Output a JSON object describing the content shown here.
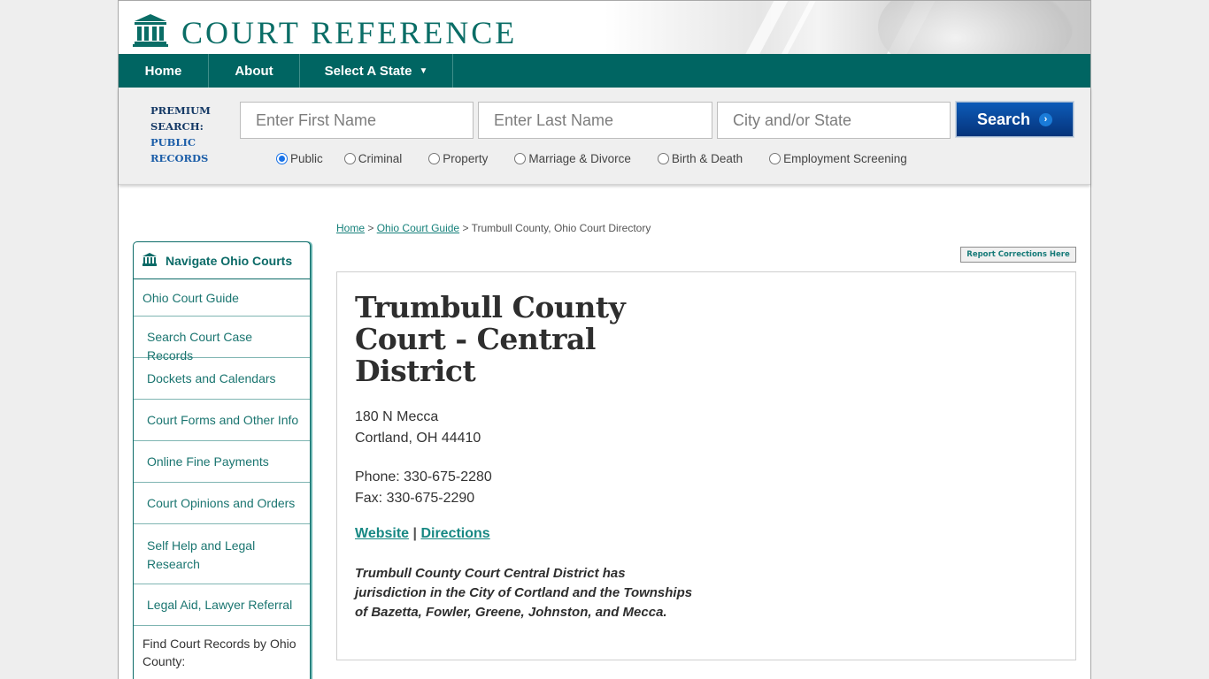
{
  "brand": {
    "name": "COURT REFERENCE",
    "logo_icon": "courthouse-icon",
    "color": "#0a6d66"
  },
  "nav": {
    "items": [
      {
        "label": "Home"
      },
      {
        "label": "About"
      },
      {
        "label": "Select A State",
        "icon": "caret-down-icon"
      }
    ]
  },
  "search": {
    "premium_line1": "PREMIUM",
    "premium_line2": "SEARCH:",
    "premium_line3": "PUBLIC",
    "premium_line4": "RECORDS",
    "first_name_placeholder": "Enter First Name",
    "last_name_placeholder": "Enter Last Name",
    "city_placeholder": "City and/or State",
    "button_label": "Search",
    "button_icon": "chevron-right-icon",
    "button_color": "#0a4fa6",
    "record_types": [
      {
        "label": "Public",
        "selected": true
      },
      {
        "label": "Criminal",
        "selected": false
      },
      {
        "label": "Property",
        "selected": false
      },
      {
        "label": "Marriage & Divorce",
        "selected": false
      },
      {
        "label": "Birth & Death",
        "selected": false
      },
      {
        "label": "Employment Screening",
        "selected": false
      }
    ]
  },
  "breadcrumb": {
    "home": "Home",
    "separator": ">",
    "guide": "Ohio Court Guide",
    "current": "Trumbull County, Ohio Court Directory"
  },
  "report_corrections_label": "Report Corrections Here",
  "sidebar": {
    "title": "Navigate Ohio Courts",
    "title_icon": "courthouse-icon",
    "items": [
      {
        "label": "Ohio Court Guide"
      },
      {
        "label": "Search Court Case Records"
      },
      {
        "label": "Dockets and Calendars"
      },
      {
        "label": "Court Forms and Other Info"
      },
      {
        "label": "Online Fine Payments"
      },
      {
        "label": "Court Opinions and Orders"
      },
      {
        "label": "Self Help and Legal Research"
      },
      {
        "label": "Legal Aid, Lawyer Referral"
      }
    ],
    "footer": "Find Court Records by Ohio County:"
  },
  "court": {
    "name": "Trumbull County Court - Central District",
    "address_line1": "180 N Mecca",
    "address_line2": "Cortland, OH 44410",
    "phone": "Phone: 330-675-2280",
    "fax": "Fax: 330-675-2290",
    "website_label": "Website",
    "link_separator": "|",
    "directions_label": "Directions",
    "description": "Trumbull County Court Central District has jurisdiction in the City of Cortland and the Townships of Bazetta, Fowler, Greene, Johnston, and Mecca."
  }
}
